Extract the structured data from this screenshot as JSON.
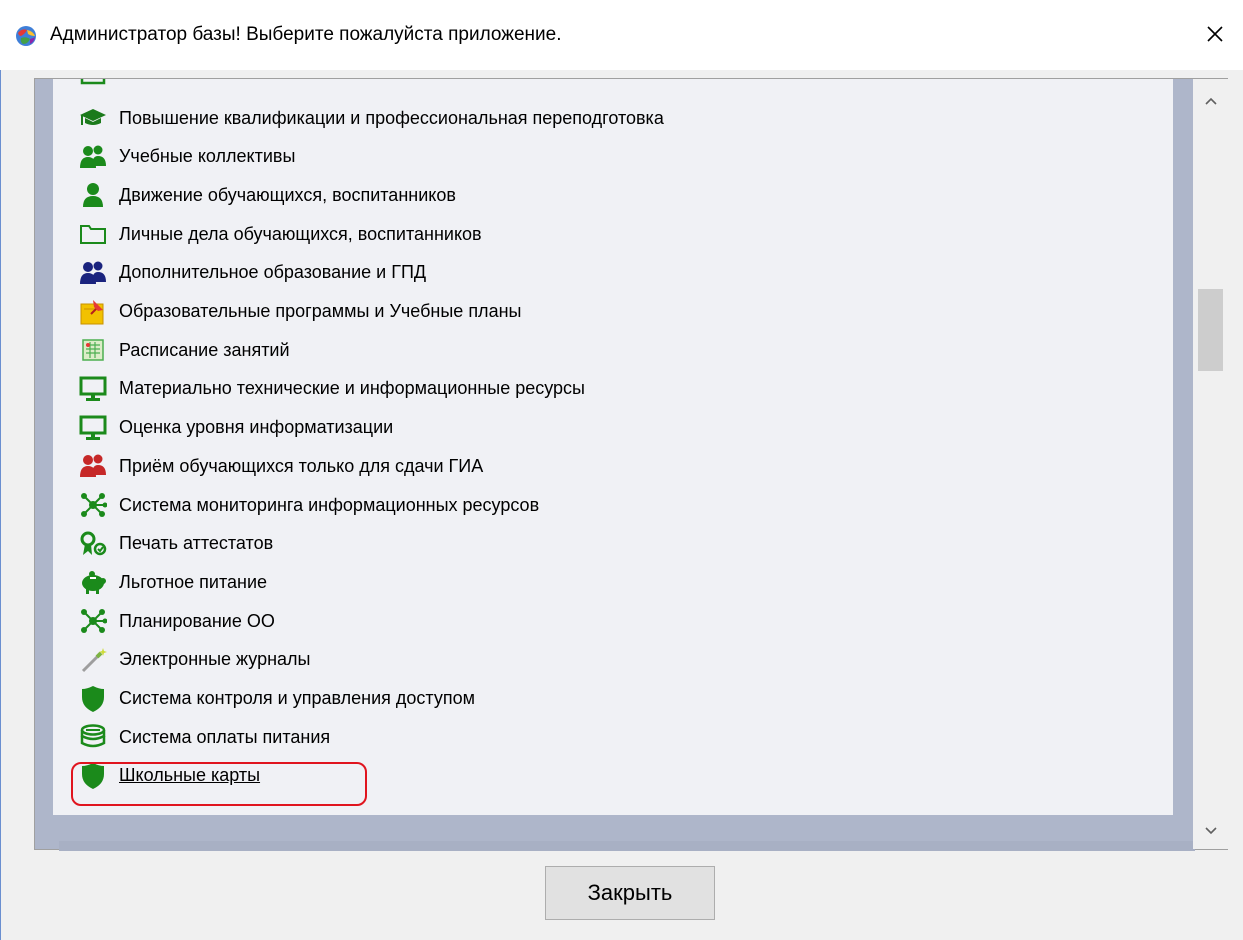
{
  "window": {
    "title": "Администратор базы! Выберите пожалуйста приложение.",
    "close_glyph": "✕"
  },
  "list": {
    "items": [
      {
        "label": "Повышение квалификации и профессиональная переподготовка",
        "icon": "graduation-cap-icon",
        "color": "#1b7a1b"
      },
      {
        "label": "Учебные коллективы",
        "icon": "users-icon",
        "color": "#1b8a1b"
      },
      {
        "label": "Движение обучающихся, воспитанников",
        "icon": "user-icon",
        "color": "#1b8a1b"
      },
      {
        "label": "Личные дела обучающихся, воспитанников",
        "icon": "folder-icon",
        "color": "#1b8a1b"
      },
      {
        "label": "Дополнительное образование и ГПД",
        "icon": "users-icon",
        "color": "#1a237e"
      },
      {
        "label": "Образовательные программы и Учебные планы",
        "icon": "pinned-note-icon",
        "color": "#f2c100"
      },
      {
        "label": "Расписание занятий",
        "icon": "schedule-icon",
        "color": "#4caf50"
      },
      {
        "label": "Материально технические и информационные ресурсы",
        "icon": "monitor-icon",
        "color": "#1b8a1b"
      },
      {
        "label": "Оценка уровня информатизации",
        "icon": "monitor-icon",
        "color": "#1b8a1b"
      },
      {
        "label": "Приём обучающихся только для сдачи ГИА",
        "icon": "users-icon",
        "color": "#c62828"
      },
      {
        "label": "Система мониторинга информационных ресурсов",
        "icon": "network-icon",
        "color": "#1b8a1b"
      },
      {
        "label": "Печать аттестатов",
        "icon": "certificate-icon",
        "color": "#1b8a1b"
      },
      {
        "label": "Льготное питание",
        "icon": "piggy-bank-icon",
        "color": "#1b8a1b"
      },
      {
        "label": "Планирование ОО",
        "icon": "network-icon",
        "color": "#1b8a1b"
      },
      {
        "label": "Электронные журналы",
        "icon": "magic-wand-icon",
        "color": "#7cb342"
      },
      {
        "label": "Система контроля и управления доступом",
        "icon": "shield-icon",
        "color": "#1b8a1b"
      },
      {
        "label": "Система оплаты питания",
        "icon": "coins-icon",
        "color": "#1b8a1b"
      },
      {
        "label": "Школьные карты",
        "icon": "shield-icon",
        "color": "#1b8a1b",
        "selected": true
      }
    ]
  },
  "footer": {
    "close_label": "Закрыть"
  },
  "colors": {
    "highlight": "#e0141e",
    "accent_green": "#1b8a1b"
  }
}
